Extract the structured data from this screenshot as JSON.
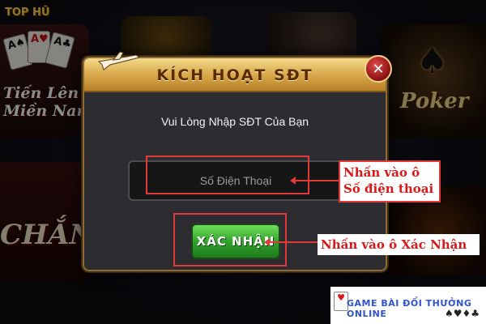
{
  "background": {
    "brand": "TOP HŨ",
    "games": [
      {
        "label": "Tiến Lên\nMiền Nam"
      },
      {
        "label": "Poker"
      },
      {
        "label": "CHẮN"
      }
    ]
  },
  "dialog": {
    "title": "KÍCH HOẠT SĐT",
    "subtitle": "Vui Lòng Nhập SĐT Của Bạn",
    "phone_input": {
      "placeholder": "Số Điện Thoại",
      "value": ""
    },
    "confirm_label": "XÁC NHẬN",
    "close_label": "✕"
  },
  "annotations": {
    "input_note": "Nhấn vào ô Số điện thoại",
    "button_note": "Nhấn vào ô Xác Nhận"
  },
  "watermark": {
    "text": "GAME BÀI ĐỔI THƯỞNG ONLINE",
    "suits": "♠♥♦♣"
  },
  "colors": {
    "accent_gold": "#d9a94c",
    "confirm_green": "#2f9e2a",
    "highlight_red": "#e23a3a"
  }
}
